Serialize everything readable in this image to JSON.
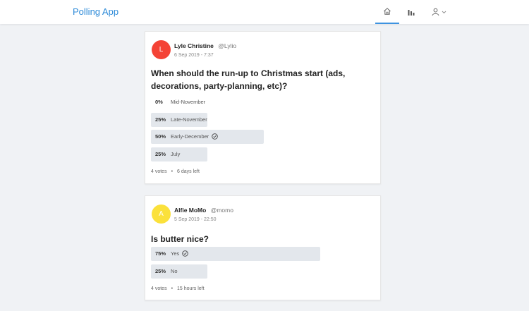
{
  "app": {
    "title": "Polling App"
  },
  "nav": {
    "home_icon": "home-icon",
    "polls_icon": "bar-chart-icon",
    "profile_icon": "user-icon",
    "active": "home",
    "accent": "#3e93e0"
  },
  "polls": [
    {
      "author": {
        "initial": "L",
        "name": "Lyle Christine",
        "handle": "@Lylio",
        "avatar_color": "#f44336"
      },
      "date": "6 Sep 2019 - 7:37",
      "question": "When should the run-up to Christmas start (ads, decorations, party-planning, etc)?",
      "choices": [
        {
          "pct": "0%",
          "percent": 0,
          "text": "Mid-November",
          "selected": false
        },
        {
          "pct": "25%",
          "percent": 25,
          "text": "Late-November",
          "selected": false
        },
        {
          "pct": "50%",
          "percent": 50,
          "text": "Early-December",
          "selected": true
        },
        {
          "pct": "25%",
          "percent": 25,
          "text": "July",
          "selected": false
        }
      ],
      "votes": "4 votes",
      "time_left": "6 days left"
    },
    {
      "author": {
        "initial": "A",
        "name": "Alfie MoMo",
        "handle": "@momo",
        "avatar_color": "#fbe13b"
      },
      "date": "5 Sep 2019 - 22:50",
      "question": "Is butter nice?",
      "choices": [
        {
          "pct": "75%",
          "percent": 75,
          "text": "Yes",
          "selected": true
        },
        {
          "pct": "25%",
          "percent": 25,
          "text": "No",
          "selected": false
        }
      ],
      "votes": "4 votes",
      "time_left": "15 hours left"
    }
  ]
}
